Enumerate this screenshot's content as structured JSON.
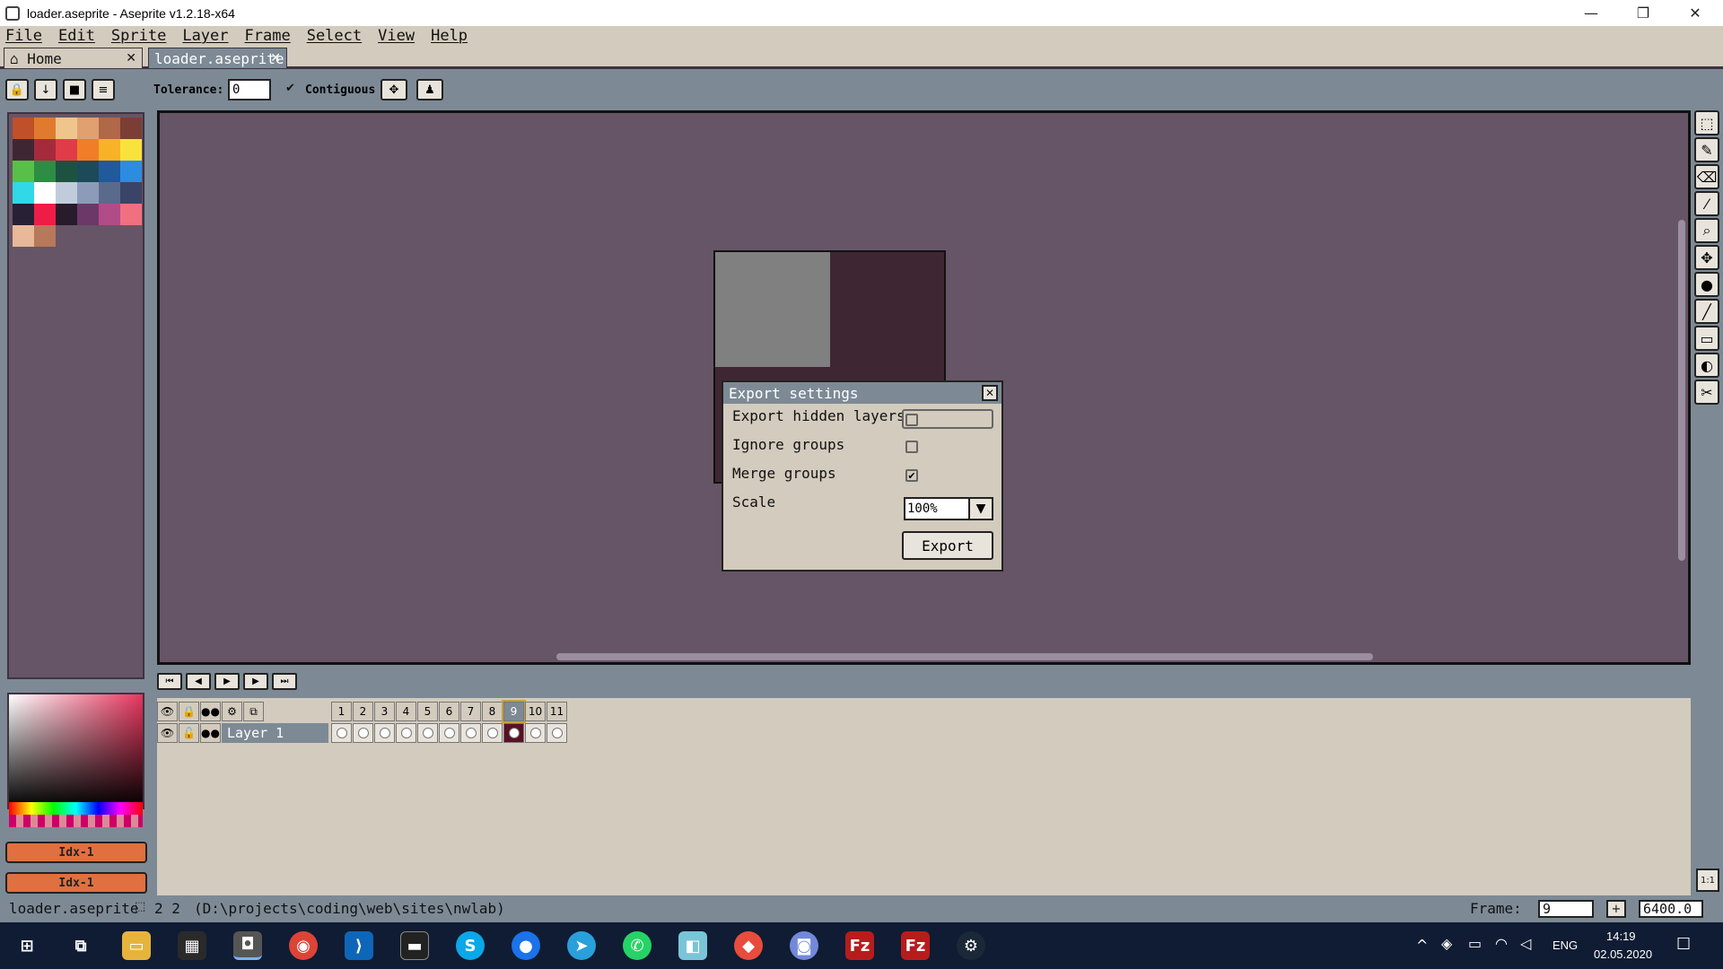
{
  "window": {
    "title": "loader.aseprite - Aseprite v1.2.18-x64",
    "minimize": "—",
    "maximize": "❐",
    "close": "✕"
  },
  "menu": [
    "File",
    "Edit",
    "Sprite",
    "Layer",
    "Frame",
    "Select",
    "View",
    "Help"
  ],
  "tabs": [
    {
      "label": "⌂ Home",
      "active": false
    },
    {
      "label": "loader.aseprite",
      "active": true
    }
  ],
  "context": {
    "tolerance_label": "Tolerance:",
    "tolerance_value": "0",
    "contiguous_label": "Contiguous",
    "contiguous_checked": true
  },
  "palette": {
    "colors": [
      "#c0502a",
      "#e07a2f",
      "#f0c58c",
      "#e0a070",
      "#b06846",
      "#7a3e34",
      "#3e2732",
      "#a52a3c",
      "#e03c48",
      "#f07e28",
      "#f8b228",
      "#f8e23c",
      "#58c048",
      "#2e8c44",
      "#1e5240",
      "#1c4a5a",
      "#205a9a",
      "#2c8ce0",
      "#30d8e8",
      "#ffffff",
      "#c0ccdc",
      "#8c9cb8",
      "#5a6a8c",
      "#3a4466",
      "#282034",
      "#f01c48",
      "#281c2c",
      "#6c3868",
      "#b04c88",
      "#f07080",
      "#e8b898",
      "#b8785c"
    ]
  },
  "dialog": {
    "title": "Export settings",
    "close": "✕",
    "fields": [
      {
        "label": "Export hidden layers",
        "checked": false
      },
      {
        "label": "Ignore groups",
        "checked": false
      },
      {
        "label": "Merge groups",
        "checked": true
      }
    ],
    "scale_label": "Scale",
    "scale_value": "100%",
    "export_button": "Export"
  },
  "timeline": {
    "frames": [
      "1",
      "2",
      "3",
      "4",
      "5",
      "6",
      "7",
      "8",
      "9",
      "10",
      "11"
    ],
    "current_frame": "9",
    "layer_name": "Layer 1"
  },
  "color": {
    "fg_label": "Idx-1",
    "bg_label": "Idx-1"
  },
  "status": {
    "filename": "loader.aseprite",
    "info": "2 2",
    "path": "(D:\\projects\\coding\\web\\sites\\nwlab)",
    "frame_label": "Frame:",
    "frame_value": "9",
    "zoom_value": "6400.0"
  },
  "taskbar": {
    "lang": "ENG",
    "time": "14:19",
    "date": "02.05.2020"
  }
}
